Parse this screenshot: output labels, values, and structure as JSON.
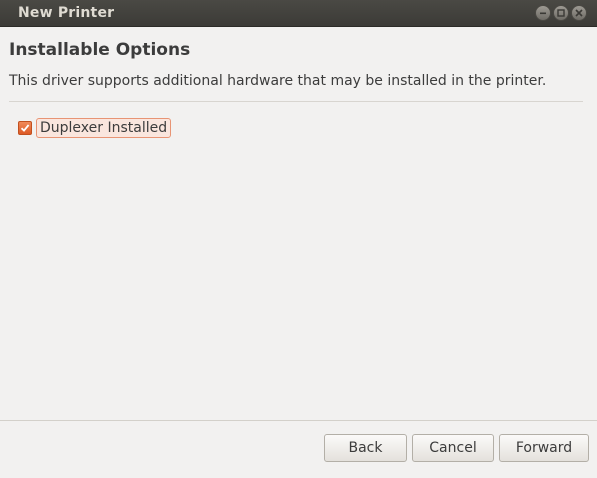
{
  "window": {
    "title": "New Printer"
  },
  "page": {
    "heading": "Installable Options",
    "description": "This driver supports additional hardware that may be installed in the printer."
  },
  "options": [
    {
      "label": "Duplexer Installed",
      "checked": true
    }
  ],
  "buttons": {
    "back": "Back",
    "cancel": "Cancel",
    "forward": "Forward"
  },
  "icons": {
    "minimize": "minimize-icon",
    "maximize": "maximize-icon",
    "close": "close-icon",
    "checkmark": "checkmark-icon"
  },
  "colors": {
    "titlebar": "#3c3b37",
    "accent": "#dd5a25",
    "background": "#f2f1f0"
  }
}
